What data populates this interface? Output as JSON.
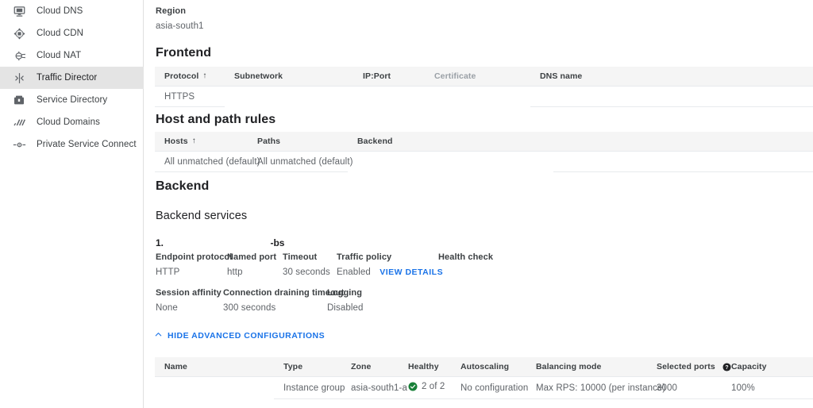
{
  "sidebar": {
    "items": [
      {
        "label": "Cloud DNS",
        "icon": "cloud-dns-icon",
        "active": false
      },
      {
        "label": "Cloud CDN",
        "icon": "cloud-cdn-icon",
        "active": false
      },
      {
        "label": "Cloud NAT",
        "icon": "cloud-nat-icon",
        "active": false
      },
      {
        "label": "Traffic Director",
        "icon": "traffic-director-icon",
        "active": true
      },
      {
        "label": "Service Directory",
        "icon": "service-directory-icon",
        "active": false
      },
      {
        "label": "Cloud Domains",
        "icon": "cloud-domains-icon",
        "active": false
      },
      {
        "label": "Private Service Connect",
        "icon": "private-service-connect-icon",
        "active": false
      }
    ]
  },
  "main": {
    "region": {
      "label": "Region",
      "value": "asia-south1"
    },
    "frontend": {
      "title": "Frontend",
      "columns": [
        "Protocol",
        "Subnetwork",
        "IP:Port",
        "Certificate",
        "DNS name"
      ],
      "sorted_column": "Protocol",
      "sort_direction": "asc",
      "rows": [
        {
          "protocol": "HTTPS",
          "subnetwork": "",
          "ip_port": "",
          "certificate": "",
          "dns_name": ""
        }
      ]
    },
    "host_path_rules": {
      "title": "Host and path rules",
      "columns": [
        "Hosts",
        "Paths",
        "Backend"
      ],
      "sorted_column": "Hosts",
      "sort_direction": "asc",
      "rows": [
        {
          "hosts": "All unmatched (default)",
          "paths": "All unmatched (default)",
          "backend": ""
        }
      ]
    },
    "backend": {
      "title": "Backend",
      "services_title": "Backend services",
      "service": {
        "index": "1.",
        "name_suffix": "-bs",
        "fields_row1": [
          {
            "key": "Endpoint protocol",
            "value": "HTTP"
          },
          {
            "key": "Named port",
            "value": "http"
          },
          {
            "key": "Timeout",
            "value": "30 seconds"
          },
          {
            "key": "Traffic policy",
            "value": "Enabled",
            "link": "VIEW DETAILS"
          },
          {
            "key": "Health check",
            "value": ""
          }
        ],
        "fields_row2": [
          {
            "key": "Session affinity",
            "value": "None"
          },
          {
            "key": "Connection draining timeout",
            "value": "300 seconds"
          },
          {
            "key": "Logging",
            "value": "Disabled"
          }
        ],
        "advanced_toggle": "HIDE ADVANCED CONFIGURATIONS",
        "advanced_toggle_chevron": "chevron-up-icon"
      },
      "instances_table": {
        "columns": [
          "Name",
          "Type",
          "Zone",
          "Healthy",
          "Autoscaling",
          "Balancing mode",
          "Selected ports",
          "Capacity"
        ],
        "selected_ports_help_icon": "help-icon",
        "rows": [
          {
            "name": "",
            "type": "Instance group",
            "zone": "asia-south1-a",
            "healthy": "2 of 2",
            "healthy_icon": "check-circle-icon",
            "autoscaling": "No configuration",
            "balancing_mode": "Max RPS: 10000 (per instance)",
            "selected_ports": "3000",
            "capacity": "100%"
          }
        ]
      }
    }
  },
  "colors": {
    "link": "#1a73e8",
    "healthy_green": "#188038",
    "header_bg": "#f5f5f5",
    "active_nav_bg": "#e4e4e4",
    "text_primary": "#202124",
    "text_secondary": "#5f6368",
    "border": "#e8eaed"
  }
}
